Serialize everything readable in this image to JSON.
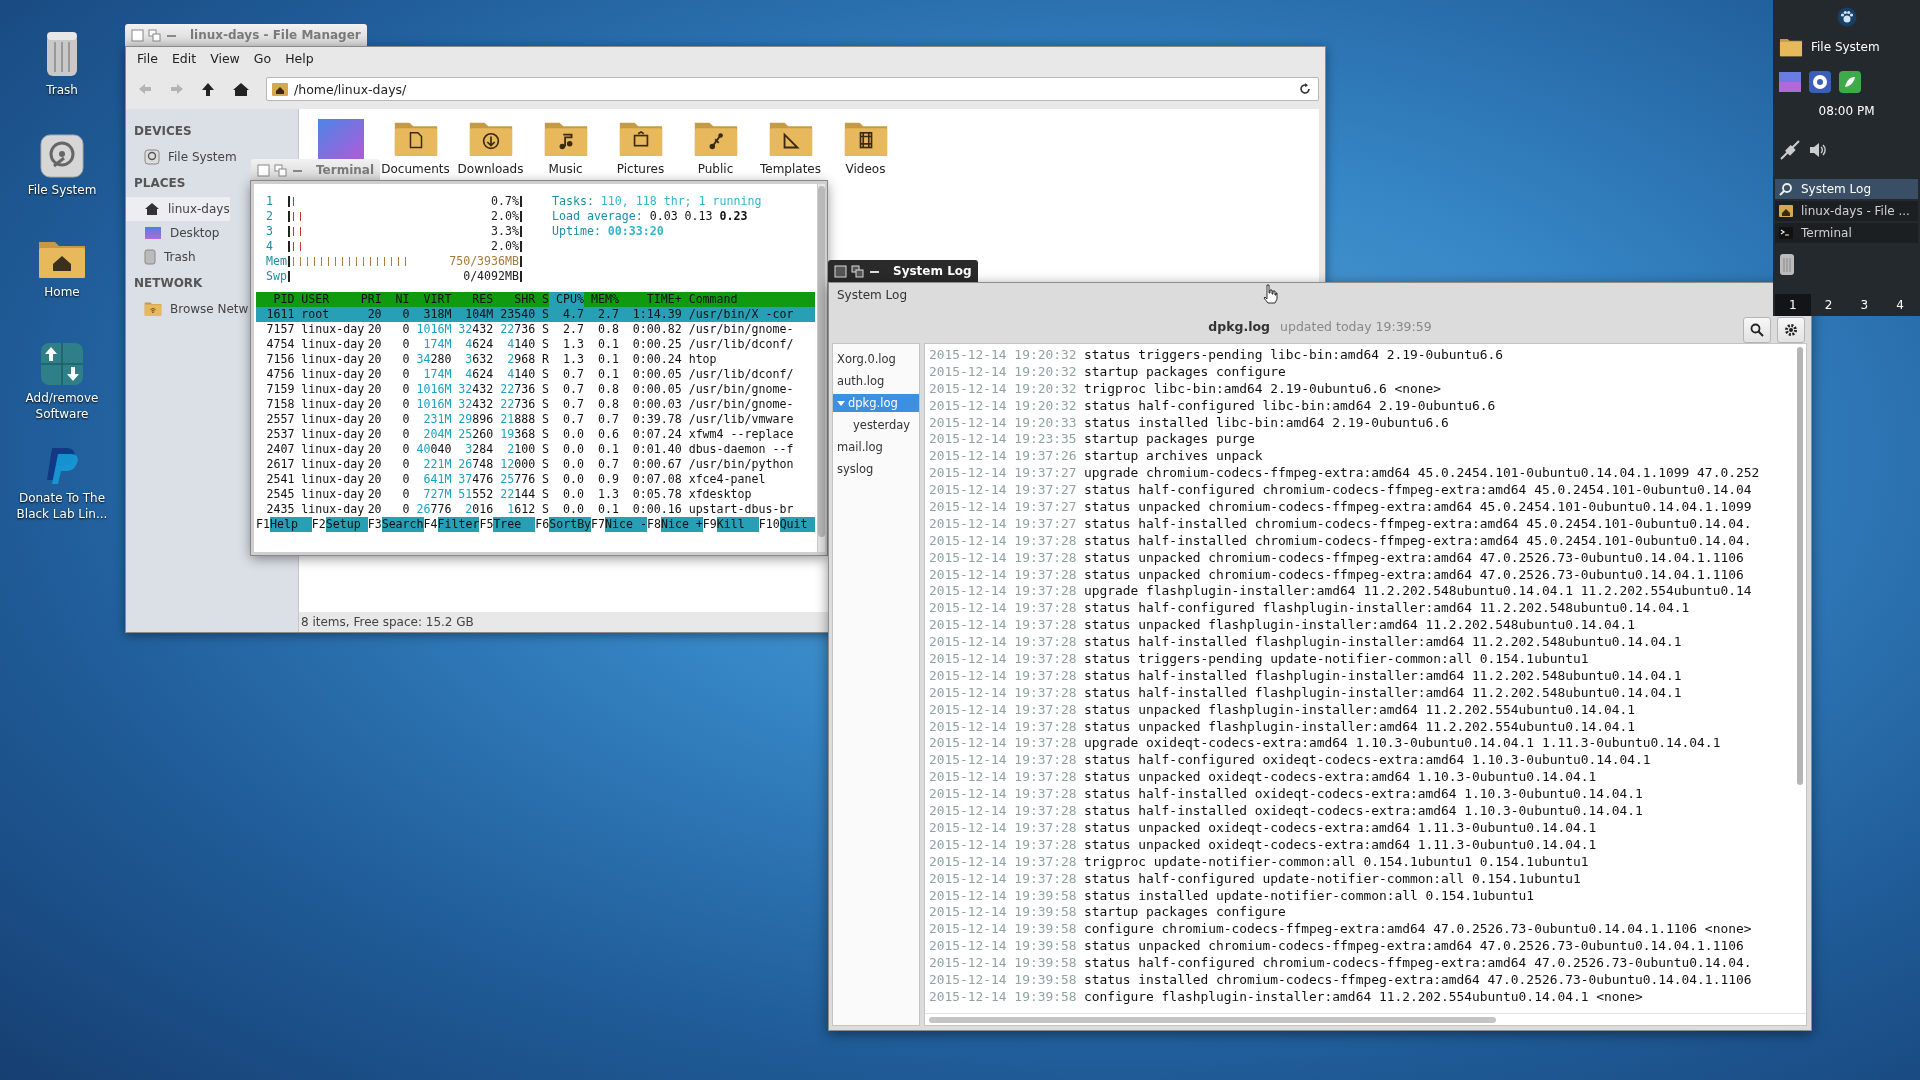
{
  "desktop_icons": [
    {
      "label": "Trash",
      "kind": "trash"
    },
    {
      "label": "File System",
      "kind": "drive"
    },
    {
      "label": "Home",
      "kind": "home"
    },
    {
      "label": "Add/remove Software",
      "kind": "software"
    },
    {
      "label": "Donate To The Black Lab Lin...",
      "kind": "paypal"
    }
  ],
  "file_manager": {
    "title": "linux-days - File Manager",
    "menu": [
      "File",
      "Edit",
      "View",
      "Go",
      "Help"
    ],
    "nav": [
      {
        "kind": "back",
        "disabled": true
      },
      {
        "kind": "forward",
        "disabled": true
      },
      {
        "kind": "up",
        "disabled": false
      },
      {
        "kind": "home",
        "disabled": false
      }
    ],
    "location": "/home/linux-days/",
    "sidebar": [
      {
        "heading": "DEVICES",
        "items": [
          {
            "label": "File System",
            "kind": "drive",
            "selected": false
          }
        ]
      },
      {
        "heading": "PLACES",
        "items": [
          {
            "label": "linux-days",
            "kind": "home",
            "selected": true
          },
          {
            "label": "Desktop",
            "kind": "desktop",
            "selected": false
          },
          {
            "label": "Trash",
            "kind": "trash",
            "selected": false
          }
        ]
      },
      {
        "heading": "NETWORK",
        "items": [
          {
            "label": "Browse Netw",
            "kind": "network",
            "selected": false
          }
        ]
      }
    ],
    "files": [
      {
        "kind": "wallpaper"
      },
      {
        "label": "Documents",
        "kind": "document"
      },
      {
        "label": "Downloads",
        "kind": "download"
      },
      {
        "label": "Music",
        "kind": "music"
      },
      {
        "label": "Pictures",
        "kind": "pictures"
      },
      {
        "label": "Public",
        "kind": "public"
      },
      {
        "label": "Templates",
        "kind": "templates"
      },
      {
        "label": "Videos",
        "kind": "video"
      }
    ],
    "status": "8 items, Free space: 15.2 GB"
  },
  "terminal": {
    "title": "Terminal",
    "meters": [
      {
        "label": "1",
        "level": 0.03,
        "reading": "0.7%"
      },
      {
        "label": "2",
        "level": 0.06,
        "reading": "2.0%"
      },
      {
        "label": "3",
        "level": 0.06,
        "reading": "3.3%"
      },
      {
        "label": "4",
        "level": 0.06,
        "reading": "2.0%"
      },
      {
        "label": "Mem",
        "level": 0.5,
        "reading": "750/3936MB"
      },
      {
        "label": "Swp",
        "reading": "0/4092MB"
      }
    ],
    "info": [
      {
        "label": "Tasks:",
        "value": "110, 118 thr; 1 running"
      },
      {
        "label": "Load average:",
        "value": "0.03 0.13 **0.23**"
      },
      {
        "label": "Uptime:",
        "value": "00:33:20"
      }
    ],
    "columns": [
      {
        "label": "PID",
        "selected": false
      },
      {
        "label": "USER",
        "selected": false
      },
      {
        "label": "PRI",
        "selected": false
      },
      {
        "label": "NI",
        "selected": false
      },
      {
        "label": "VIRT",
        "selected": false
      },
      {
        "label": "RES",
        "selected": false
      },
      {
        "label": "SHR",
        "selected": false
      },
      {
        "label": "S",
        "selected": false
      },
      {
        "label": "CPU%",
        "selected": true
      },
      {
        "label": "MEM%",
        "selected": false
      },
      {
        "label": "TIME+",
        "selected": false
      },
      {
        "label": "Command",
        "selected": false
      }
    ],
    "processes": [
      {
        "cells": [
          "1611",
          "root",
          "20",
          "0",
          "318M",
          "104M",
          "23540",
          "S",
          "4.7",
          "2.7",
          "1:14.39",
          "/usr/bin/X -cor"
        ],
        "selected": true
      },
      {
        "cells": [
          "7157",
          "linux-day",
          "20",
          "0",
          "1016M",
          "32432",
          "22736",
          "S",
          "2.7",
          "0.8",
          "0:00.82",
          "/usr/bin/gnome-"
        ],
        "selected": false
      },
      {
        "cells": [
          "4754",
          "linux-day",
          "20",
          "0",
          "174M",
          "4624",
          "4140",
          "S",
          "1.3",
          "0.1",
          "0:00.25",
          "/usr/lib/dconf/"
        ],
        "selected": false
      },
      {
        "cells": [
          "7156",
          "linux-day",
          "20",
          "0",
          "34280",
          "3632",
          "2968",
          "R",
          "1.3",
          "0.1",
          "0:00.24",
          "htop"
        ],
        "selected": false
      },
      {
        "cells": [
          "4756",
          "linux-day",
          "20",
          "0",
          "174M",
          "4624",
          "4140",
          "S",
          "0.7",
          "0.1",
          "0:00.05",
          "/usr/lib/dconf/"
        ],
        "selected": false
      },
      {
        "cells": [
          "7159",
          "linux-day",
          "20",
          "0",
          "1016M",
          "32432",
          "22736",
          "S",
          "0.7",
          "0.8",
          "0:00.05",
          "/usr/bin/gnome-"
        ],
        "selected": false
      },
      {
        "cells": [
          "7158",
          "linux-day",
          "20",
          "0",
          "1016M",
          "32432",
          "22736",
          "S",
          "0.7",
          "0.8",
          "0:00.03",
          "/usr/bin/gnome-"
        ],
        "selected": false
      },
      {
        "cells": [
          "2557",
          "linux-day",
          "20",
          "0",
          "231M",
          "29896",
          "21888",
          "S",
          "0.7",
          "0.7",
          "0:39.78",
          "/usr/lib/vmware"
        ],
        "selected": false
      },
      {
        "cells": [
          "2537",
          "linux-day",
          "20",
          "0",
          "204M",
          "25260",
          "19368",
          "S",
          "0.0",
          "0.6",
          "0:07.24",
          "xfwm4 --replace"
        ],
        "selected": false
      },
      {
        "cells": [
          "2407",
          "linux-day",
          "20",
          "0",
          "40040",
          "3284",
          "2100",
          "S",
          "0.0",
          "0.1",
          "0:01.40",
          "dbus-daemon --f"
        ],
        "selected": false
      },
      {
        "cells": [
          "2617",
          "linux-day",
          "20",
          "0",
          "221M",
          "26748",
          "12000",
          "S",
          "0.0",
          "0.7",
          "0:00.67",
          "/usr/bin/python"
        ],
        "selected": false
      },
      {
        "cells": [
          "2541",
          "linux-day",
          "20",
          "0",
          "641M",
          "37476",
          "25776",
          "S",
          "0.0",
          "0.9",
          "0:07.08",
          "xfce4-panel"
        ],
        "selected": false
      },
      {
        "cells": [
          "2545",
          "linux-day",
          "20",
          "0",
          "727M",
          "51552",
          "22144",
          "S",
          "0.0",
          "1.3",
          "0:05.78",
          "xfdesktop"
        ],
        "selected": false
      },
      {
        "cells": [
          "2435",
          "linux-day",
          "20",
          "0",
          "26776",
          "2016",
          "1612",
          "S",
          "0.0",
          "0.1",
          "0:00.16",
          "upstart-dbus-br"
        ],
        "selected": false
      }
    ],
    "function_keys": [
      {
        "key": "F1",
        "label": "Help"
      },
      {
        "key": "F2",
        "label": "Setup"
      },
      {
        "key": "F3",
        "label": "Search"
      },
      {
        "key": "F4",
        "label": "Filter"
      },
      {
        "key": "F5",
        "label": "Tree"
      },
      {
        "key": "F6",
        "label": "SortBy"
      },
      {
        "key": "F7",
        "label": "Nice -"
      },
      {
        "key": "F8",
        "label": "Nice +"
      },
      {
        "key": "F9",
        "label": "Kill"
      },
      {
        "key": "F10",
        "label": "Quit"
      }
    ]
  },
  "system_log": {
    "title": "System Log",
    "toolbar_title": "System Log",
    "file": "dpkg.log",
    "updated": "updated today 19:39:59",
    "logs": [
      {
        "label": "Xorg.0.log",
        "selected": false
      },
      {
        "label": "auth.log",
        "selected": false
      },
      {
        "label": "dpkg.log",
        "selected": true,
        "expanded": true,
        "children": [
          {
            "label": "yesterday",
            "selected": false
          }
        ]
      },
      {
        "label": "mail.log",
        "selected": false
      },
      {
        "label": "syslog",
        "selected": false
      }
    ],
    "lines": [
      {
        "time": "2015-12-14 19:20:32",
        "text": "status triggers-pending libc-bin:amd64 2.19-0ubuntu6.6"
      },
      {
        "time": "2015-12-14 19:20:32",
        "text": "startup packages configure"
      },
      {
        "time": "2015-12-14 19:20:32",
        "text": "trigproc libc-bin:amd64 2.19-0ubuntu6.6 <none>"
      },
      {
        "time": "2015-12-14 19:20:32",
        "text": "status half-configured libc-bin:amd64 2.19-0ubuntu6.6"
      },
      {
        "time": "2015-12-14 19:20:33",
        "text": "status installed libc-bin:amd64 2.19-0ubuntu6.6"
      },
      {
        "time": "2015-12-14 19:23:35",
        "text": "startup packages purge"
      },
      {
        "time": "2015-12-14 19:37:26",
        "text": "startup archives unpack"
      },
      {
        "time": "2015-12-14 19:37:27",
        "text": "upgrade chromium-codecs-ffmpeg-extra:amd64 45.0.2454.101-0ubuntu0.14.04.1.1099 47.0.252"
      },
      {
        "time": "2015-12-14 19:37:27",
        "text": "status half-configured chromium-codecs-ffmpeg-extra:amd64 45.0.2454.101-0ubuntu0.14.04"
      },
      {
        "time": "2015-12-14 19:37:27",
        "text": "status unpacked chromium-codecs-ffmpeg-extra:amd64 45.0.2454.101-0ubuntu0.14.04.1.1099"
      },
      {
        "time": "2015-12-14 19:37:27",
        "text": "status half-installed chromium-codecs-ffmpeg-extra:amd64 45.0.2454.101-0ubuntu0.14.04."
      },
      {
        "time": "2015-12-14 19:37:28",
        "text": "status half-installed chromium-codecs-ffmpeg-extra:amd64 45.0.2454.101-0ubuntu0.14.04."
      },
      {
        "time": "2015-12-14 19:37:28",
        "text": "status unpacked chromium-codecs-ffmpeg-extra:amd64 47.0.2526.73-0ubuntu0.14.04.1.1106"
      },
      {
        "time": "2015-12-14 19:37:28",
        "text": "status unpacked chromium-codecs-ffmpeg-extra:amd64 47.0.2526.73-0ubuntu0.14.04.1.1106"
      },
      {
        "time": "2015-12-14 19:37:28",
        "text": "upgrade flashplugin-installer:amd64 11.2.202.548ubuntu0.14.04.1 11.2.202.554ubuntu0.14"
      },
      {
        "time": "2015-12-14 19:37:28",
        "text": "status half-configured flashplugin-installer:amd64 11.2.202.548ubuntu0.14.04.1"
      },
      {
        "time": "2015-12-14 19:37:28",
        "text": "status unpacked flashplugin-installer:amd64 11.2.202.548ubuntu0.14.04.1"
      },
      {
        "time": "2015-12-14 19:37:28",
        "text": "status half-installed flashplugin-installer:amd64 11.2.202.548ubuntu0.14.04.1"
      },
      {
        "time": "2015-12-14 19:37:28",
        "text": "status triggers-pending update-notifier-common:all 0.154.1ubuntu1"
      },
      {
        "time": "2015-12-14 19:37:28",
        "text": "status half-installed flashplugin-installer:amd64 11.2.202.548ubuntu0.14.04.1"
      },
      {
        "time": "2015-12-14 19:37:28",
        "text": "status half-installed flashplugin-installer:amd64 11.2.202.548ubuntu0.14.04.1"
      },
      {
        "time": "2015-12-14 19:37:28",
        "text": "status unpacked flashplugin-installer:amd64 11.2.202.554ubuntu0.14.04.1"
      },
      {
        "time": "2015-12-14 19:37:28",
        "text": "status unpacked flashplugin-installer:amd64 11.2.202.554ubuntu0.14.04.1"
      },
      {
        "time": "2015-12-14 19:37:28",
        "text": "upgrade oxideqt-codecs-extra:amd64 1.10.3-0ubuntu0.14.04.1 1.11.3-0ubuntu0.14.04.1"
      },
      {
        "time": "2015-12-14 19:37:28",
        "text": "status half-configured oxideqt-codecs-extra:amd64 1.10.3-0ubuntu0.14.04.1"
      },
      {
        "time": "2015-12-14 19:37:28",
        "text": "status unpacked oxideqt-codecs-extra:amd64 1.10.3-0ubuntu0.14.04.1"
      },
      {
        "time": "2015-12-14 19:37:28",
        "text": "status half-installed oxideqt-codecs-extra:amd64 1.10.3-0ubuntu0.14.04.1"
      },
      {
        "time": "2015-12-14 19:37:28",
        "text": "status half-installed oxideqt-codecs-extra:amd64 1.10.3-0ubuntu0.14.04.1"
      },
      {
        "time": "2015-12-14 19:37:28",
        "text": "status unpacked oxideqt-codecs-extra:amd64 1.11.3-0ubuntu0.14.04.1"
      },
      {
        "time": "2015-12-14 19:37:28",
        "text": "status unpacked oxideqt-codecs-extra:amd64 1.11.3-0ubuntu0.14.04.1"
      },
      {
        "time": "2015-12-14 19:37:28",
        "text": "trigproc update-notifier-common:all 0.154.1ubuntu1 0.154.1ubuntu1"
      },
      {
        "time": "2015-12-14 19:37:28",
        "text": "status half-configured update-notifier-common:all 0.154.1ubuntu1"
      },
      {
        "time": "2015-12-14 19:39:58",
        "text": "status installed update-notifier-common:all 0.154.1ubuntu1"
      },
      {
        "time": "2015-12-14 19:39:58",
        "text": "startup packages configure"
      },
      {
        "time": "2015-12-14 19:39:58",
        "text": "configure chromium-codecs-ffmpeg-extra:amd64 47.0.2526.73-0ubuntu0.14.04.1.1106 <none>"
      },
      {
        "time": "2015-12-14 19:39:58",
        "text": "status unpacked chromium-codecs-ffmpeg-extra:amd64 47.0.2526.73-0ubuntu0.14.04.1.1106"
      },
      {
        "time": "2015-12-14 19:39:58",
        "text": "status half-configured chromium-codecs-ffmpeg-extra:amd64 47.0.2526.73-0ubuntu0.14.04."
      },
      {
        "time": "2015-12-14 19:39:58",
        "text": "status installed chromium-codecs-ffmpeg-extra:amd64 47.0.2526.73-0ubuntu0.14.04.1.1106"
      },
      {
        "time": "2015-12-14 19:39:58",
        "text": "configure flashplugin-installer:amd64 11.2.202.554ubuntu0.14.04.1 <none>"
      }
    ]
  },
  "panel": {
    "places": [
      {
        "label": "File System"
      }
    ],
    "launchers": [
      {
        "kind": "wallpaper"
      },
      {
        "kind": "browser"
      },
      {
        "kind": "app"
      }
    ],
    "clock": "08:00 PM",
    "indicators": [
      {
        "kind": "network"
      },
      {
        "kind": "volume"
      }
    ],
    "tasks": [
      {
        "label": "System Log",
        "kind": "log",
        "selected": true
      },
      {
        "label": "linux-days - File ...",
        "kind": "folder",
        "selected": false
      },
      {
        "label": "Terminal",
        "kind": "terminal",
        "selected": false
      }
    ],
    "workspaces": [
      {
        "label": "1",
        "selected": true
      },
      {
        "label": "2",
        "selected": false
      },
      {
        "label": "3",
        "selected": false
      },
      {
        "label": "4",
        "selected": false
      }
    ]
  }
}
